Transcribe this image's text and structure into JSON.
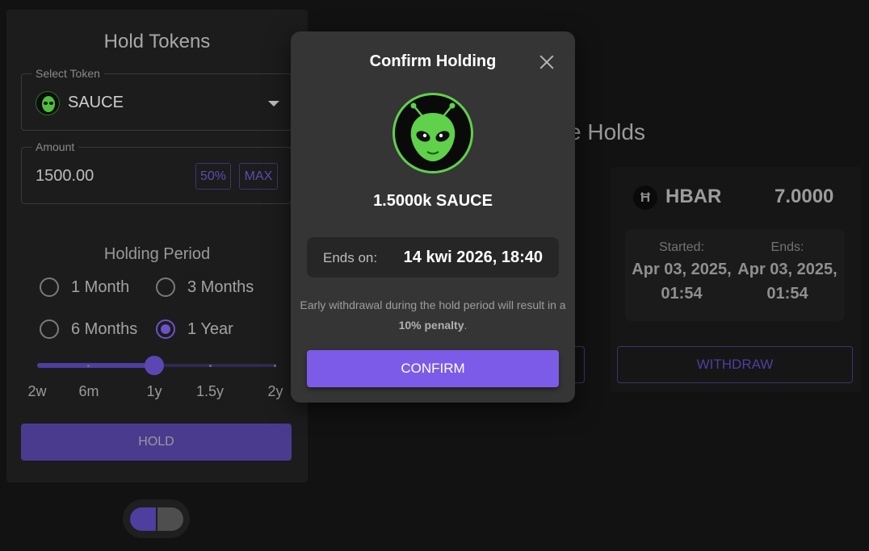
{
  "hold_form": {
    "title": "Hold Tokens",
    "select_token": {
      "label": "Select Token",
      "value": "SAUCE"
    },
    "amount": {
      "label": "Amount",
      "value": "1500.00",
      "pct_50_label": "50%",
      "max_label": "MAX"
    },
    "holding_period": {
      "title": "Holding Period",
      "options": [
        {
          "label": "1 Month",
          "selected": false
        },
        {
          "label": "3 Months",
          "selected": false
        },
        {
          "label": "6 Months",
          "selected": false
        },
        {
          "label": "1 Year",
          "selected": true
        }
      ]
    },
    "slider": {
      "ticks": [
        "2w",
        "6m",
        "1y",
        "1.5y",
        "2y"
      ],
      "selected": "1y"
    },
    "hold_button_label": "HOLD"
  },
  "active_holds": {
    "title": "ve Holds",
    "hold": {
      "symbol": "HBAR",
      "icon_glyph": "Ħ",
      "amount": "7.0000",
      "started_label": "Started:",
      "started_value": "Apr 03, 2025, 01:54",
      "ends_label": "Ends:",
      "ends_value": "Apr 03, 2025, 01:54",
      "withdraw_label": "WITHDRAW"
    }
  },
  "modal": {
    "title": "Confirm Holding",
    "amount_text": "1.5000k SAUCE",
    "ends_label": "Ends on:",
    "ends_value": "14 kwi 2026, 18:40",
    "warning_prefix": "Early withdrawal during the hold period will result in a ",
    "warning_penalty": "10% penalty",
    "warning_suffix": ".",
    "confirm_label": "CONFIRM"
  },
  "colors": {
    "accent": "#7c5be8",
    "accent_dim": "#4a3b8f",
    "alien_green": "#5fd14a",
    "modal_bg": "#353535"
  }
}
